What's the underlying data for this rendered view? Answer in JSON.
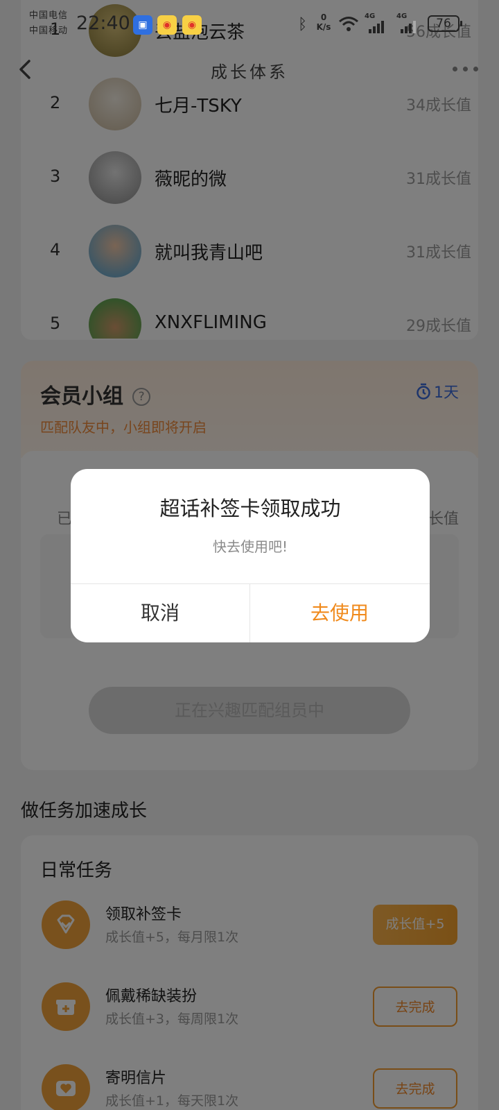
{
  "status_bar": {
    "carrier1": "中国电信",
    "carrier2": "中国移动",
    "time": "22:40",
    "net_speed_value": "0",
    "net_speed_unit": "K/s",
    "sig1_label": "4G",
    "sig2_label": "4G",
    "battery": "76"
  },
  "nav": {
    "title": "成长体系"
  },
  "ranking": [
    {
      "rank": "1",
      "name": "丢盐泡云茶",
      "score": "56成长值"
    },
    {
      "rank": "2",
      "name": "七月-TSKY",
      "score": "34成长值"
    },
    {
      "rank": "3",
      "name": "薇昵的微",
      "score": "31成长值"
    },
    {
      "rank": "4",
      "name": "就叫我青山吧",
      "score": "31成长值"
    },
    {
      "rank": "5",
      "name": "XNXFLIMING",
      "score": "29成长值"
    }
  ],
  "group": {
    "title": "会员小组",
    "subtitle": "匹配队友中，小组即将开启",
    "days": "1天",
    "ghost_left": "已",
    "ghost_right": "长值",
    "matching_button": "正在兴趣匹配组员中"
  },
  "tasks": {
    "section_title": "做任务加速成长",
    "header": "日常任务",
    "items": [
      {
        "name": "领取补签卡",
        "desc": "成长值+5，每月限1次",
        "button": "成长值+5"
      },
      {
        "name": "佩戴稀缺装扮",
        "desc": "成长值+3，每周限1次",
        "button": "去完成"
      },
      {
        "name": "寄明信片",
        "desc": "成长值+1，每天限1次",
        "button": "去完成"
      }
    ]
  },
  "dialog": {
    "title": "超话补签卡领取成功",
    "message": "快去使用吧!",
    "cancel": "取消",
    "confirm": "去使用"
  },
  "colors": {
    "accent": "#f08a1c",
    "overlay": "rgba(0,0,0,0.5)"
  }
}
